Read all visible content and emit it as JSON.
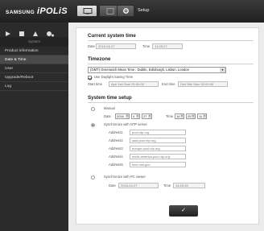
{
  "header": {
    "brand_samsung": "SAMSUNG",
    "brand_ipolis": "iPOLiS",
    "title": "Setup"
  },
  "sidebar": {
    "heading": "System",
    "items": [
      {
        "label": "Product information"
      },
      {
        "label": "Date & Time",
        "active": true
      },
      {
        "label": "User"
      },
      {
        "label": "Upgrade/Reboot"
      },
      {
        "label": "Log"
      }
    ]
  },
  "current_time": {
    "title": "Current system time",
    "date_label": "Date",
    "date_value": "2016-04-27",
    "time_label": "Time",
    "time_value": "14:25:27"
  },
  "timezone": {
    "title": "Timezone",
    "selected": "(GMT) Greenwich Mean Time : Dublin, Edinburgh, Lisbon, London",
    "dst_label": "Use Daylight Saving Time",
    "dst_checked": true,
    "start_label": "Start time",
    "start_value": "Apr/ 1st/ Sun/ 01:00:00",
    "end_label": "End time",
    "end_value": "Oct/ 5th/ Sun/ 02:00:00"
  },
  "setup": {
    "title": "System time setup",
    "manual_label": "Manual",
    "date_label": "Date",
    "year": "2016",
    "month": "4",
    "day": "27",
    "time_label": "Time",
    "hour": "14",
    "minute": "25",
    "second": "11",
    "ntp_label": "Synchronize with NTP server",
    "ntp_addresses": [
      {
        "label": "Address1",
        "value": "pool.ntp.org"
      },
      {
        "label": "Address2",
        "value": "asia.pool.ntp.org"
      },
      {
        "label": "Address3",
        "value": "europe.pool.ntp.org"
      },
      {
        "label": "Address4",
        "value": "north-america.pool.ntp.org"
      },
      {
        "label": "Address5",
        "value": "time.nist.gov"
      }
    ],
    "pc_label": "Synchronize with PC viewer",
    "pc_date_label": "Date",
    "pc_date_value": "2016-04-27",
    "pc_time_label": "Time",
    "pc_time_value": "14:25:28",
    "apply_label": "✓"
  }
}
